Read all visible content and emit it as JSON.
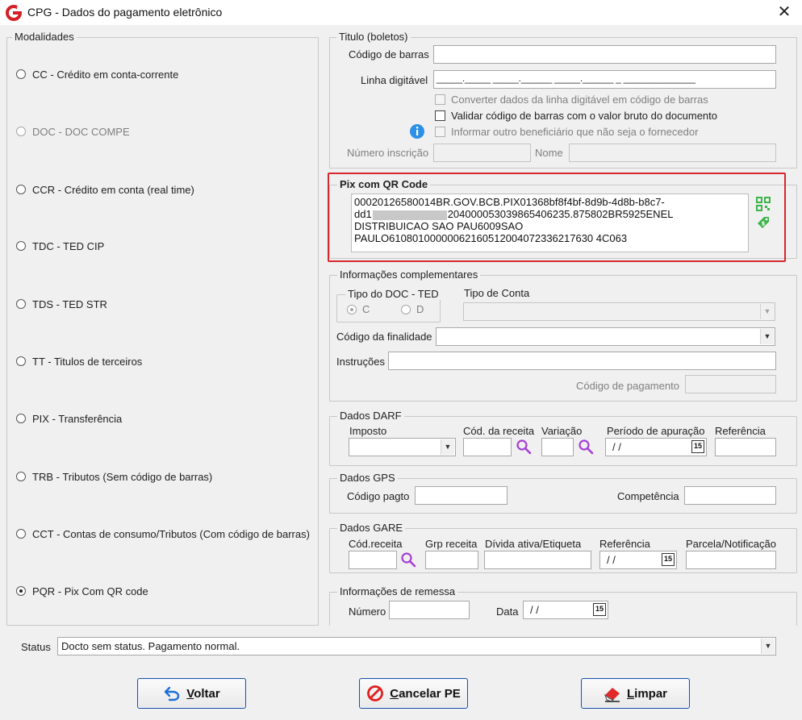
{
  "window": {
    "title": "CPG - Dados do pagamento eletrônico",
    "close_glyph": "✕",
    "brand_color": "#d42027"
  },
  "modalidades": {
    "legend": "Modalidades",
    "options": [
      {
        "label": "CC  - Crédito em conta-corrente",
        "enabled": true,
        "selected": false
      },
      {
        "label": "DOC - DOC COMPE",
        "enabled": false,
        "selected": false
      },
      {
        "label": "CCR - Crédito em conta (real time)",
        "enabled": true,
        "selected": false
      },
      {
        "label": "TDC - TED CIP",
        "enabled": true,
        "selected": false
      },
      {
        "label": "TDS - TED STR",
        "enabled": true,
        "selected": false
      },
      {
        "label": "TT  - Titulos de terceiros",
        "enabled": true,
        "selected": false
      },
      {
        "label": "PIX - Transferência",
        "enabled": true,
        "selected": false
      },
      {
        "label": "TRB - Tributos (Sem código de barras)",
        "enabled": true,
        "selected": false
      },
      {
        "label": "CCT - Contas de consumo/Tributos (Com código de barras)",
        "enabled": true,
        "selected": false
      },
      {
        "label": "PQR - Pix Com QR code",
        "enabled": true,
        "selected": true
      }
    ]
  },
  "titulo": {
    "legend": "Titulo (boletos)",
    "codigo_barras_label": "Código de barras",
    "codigo_barras_value": "",
    "linha_digitavel_label": "Linha digitável",
    "linha_digitavel_mask": "_____._____ _____.______ _____.______ _ ______________",
    "chk_converter": "Converter dados da linha digitável em código de barras",
    "chk_validar": "Validar código de barras com o valor bruto do documento",
    "chk_informar": "Informar outro beneficiário que não seja o fornecedor",
    "numero_inscricao_label": "Número inscrição",
    "nome_label": "Nome",
    "info_icon": "info-icon"
  },
  "pix": {
    "legend": "Pix com QR Code",
    "line1": "00020126580014BR.GOV.BCB.PIX01368bf8f4bf-8d9b-4d8b-b8c7-",
    "line2_prefix": "dd1",
    "line2_suffix": "204000053039865406235.875802BR5925ENEL",
    "line3": "DISTRIBUICAO SAO PAU6009SAO",
    "line4": "PAULO61080100000062160512004072336217630 4C063",
    "qr_icon": "qr-code-icon",
    "money_icon": "money-tag-icon",
    "highlight_color": "#d5282f"
  },
  "info_compl": {
    "legend": "Informações complementares",
    "tipo_doc_legend": "Tipo do DOC - TED",
    "radio_c": "C",
    "radio_d": "D",
    "tipo_conta_label": "Tipo de Conta",
    "codigo_finalidade_label": "Código da finalidade",
    "instrucoes_label": "Instruções",
    "codigo_pagamento_label": "Código de pagamento"
  },
  "darf": {
    "legend": "Dados DARF",
    "imposto_label": "Imposto",
    "cod_receita_label": "Cód. da receita",
    "variacao_label": "Variação",
    "periodo_label": "Período de apuração",
    "referencia_label": "Referência",
    "periodo_value": "/ /"
  },
  "gps": {
    "legend": "Dados GPS",
    "codigo_pagto_label": "Código pagto",
    "competencia_label": "Competência"
  },
  "gare": {
    "legend": "Dados GARE",
    "cod_receita_label": "Cód.receita",
    "grp_receita_label": "Grp receita",
    "divida_label": "Dívida ativa/Etiqueta",
    "referencia_label": "Referência",
    "parcela_label": "Parcela/Notificação",
    "referencia_value": "/ /"
  },
  "remessa": {
    "legend": "Informações de remessa",
    "numero_label": "Número",
    "data_label": "Data",
    "data_value": "/ /"
  },
  "status": {
    "label": "Status",
    "value": "Docto sem status. Pagamento normal."
  },
  "buttons": {
    "voltar_u": "V",
    "voltar_rest": "oltar",
    "cancelar_u": "C",
    "cancelar_rest": "ancelar PE",
    "limpar_u": "L",
    "limpar_rest": "impar"
  },
  "calendar_glyph": "15",
  "dropdown_glyph": "▼"
}
